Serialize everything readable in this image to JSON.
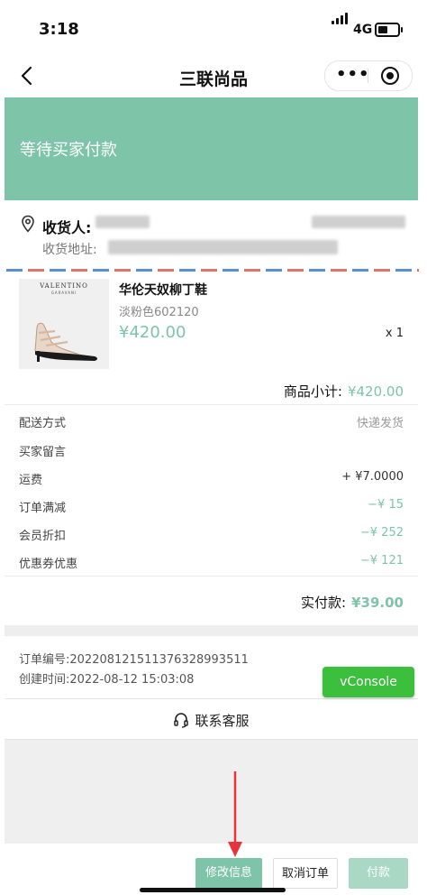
{
  "status_bar": {
    "time": "3:18",
    "network": "4G"
  },
  "nav": {
    "title": "三联尚品",
    "more_icon": "more-dots-icon",
    "close_icon": "target-icon"
  },
  "banner": {
    "status_text": "等待买家付款",
    "color": "#7ec4a8"
  },
  "address": {
    "receiver_label": "收货人:",
    "address_label": "收货地址:"
  },
  "product": {
    "name": "华伦天奴柳丁鞋",
    "spec": "淡粉色602120",
    "price": "¥420.00",
    "quantity": "x 1",
    "thumb_brand": "VALENTINO",
    "thumb_sub": "GARAVANI"
  },
  "subtotal": {
    "label": "商品小计:",
    "amount": "¥420.00"
  },
  "rows": [
    {
      "label": "配送方式",
      "value": "快递发货"
    },
    {
      "label": "买家留言",
      "value": ""
    },
    {
      "label": "运费",
      "value": "+ ¥7.0000"
    },
    {
      "label": "订单满减",
      "value": "−¥ 15"
    },
    {
      "label": "会员折扣",
      "value": "−¥ 252"
    },
    {
      "label": "优惠券优惠",
      "value": "−¥ 121"
    }
  ],
  "paid": {
    "label": "实付款:",
    "amount": "¥39.00"
  },
  "order": {
    "number": "订单编号:20220812151137632899351​1",
    "created": "创建时间:2022-08-12 15:03:08"
  },
  "vconsole": {
    "label": "vConsole"
  },
  "contact": {
    "label": "联系客服"
  },
  "actions": {
    "edit": "修改信息",
    "cancel": "取消订单",
    "pay": "付款"
  },
  "colors": {
    "accent": "#7ec4a8",
    "vconsole": "#3cbf3c",
    "annotation_arrow": "#e8333a"
  }
}
